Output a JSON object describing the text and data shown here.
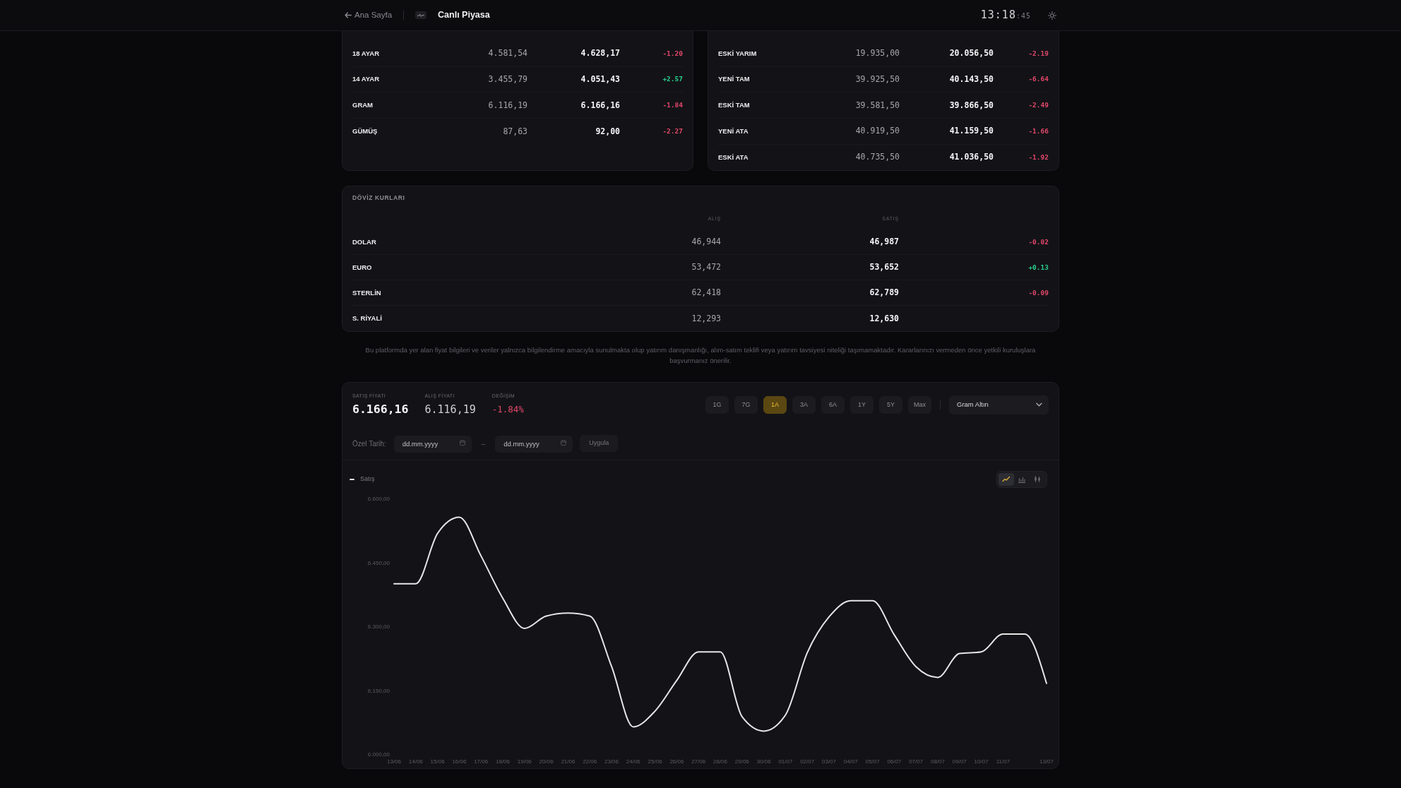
{
  "header": {
    "back_link": "Ana Sayfa",
    "title": "Canlı Piyasa",
    "clock": {
      "time": "13:18",
      "seconds": ":45"
    }
  },
  "gold_tables": [
    {
      "rows": [
        {
          "name": "18 AYAR",
          "buy": "4.581,54",
          "sell": "4.628,17",
          "change": "-1.20",
          "color": "#e2476a"
        },
        {
          "name": "14 AYAR",
          "buy": "3.455,79",
          "sell": "4.051,43",
          "change": "+2.57",
          "color": "#2bcf8e"
        },
        {
          "name": "GRAM",
          "buy": "6.116,19",
          "sell": "6.166,16",
          "change": "-1.84",
          "color": "#e2476a"
        },
        {
          "name": "GÜMÜŞ",
          "buy": "87,63",
          "sell": "92,00",
          "change": "-2.27",
          "color": "#e2476a"
        }
      ]
    },
    {
      "rows": [
        {
          "name": "ESKİ YARIM",
          "buy": "19.935,00",
          "sell": "20.056,50",
          "change": "-2.19",
          "color": "#e2476a"
        },
        {
          "name": "YENİ TAM",
          "buy": "39.925,50",
          "sell": "40.143,50",
          "change": "-6.64",
          "color": "#e2476a"
        },
        {
          "name": "ESKİ TAM",
          "buy": "39.581,50",
          "sell": "39.866,50",
          "change": "-2.49",
          "color": "#e2476a"
        },
        {
          "name": "YENİ ATA",
          "buy": "40.919,50",
          "sell": "41.159,50",
          "change": "-1.66",
          "color": "#e2476a"
        },
        {
          "name": "ESKİ ATA",
          "buy": "40.735,50",
          "sell": "41.036,50",
          "change": "-1.92",
          "color": "#e2476a"
        }
      ]
    }
  ],
  "currency": {
    "title": "DÖVİZ KURLARI",
    "columns": [
      "ALIŞ",
      "SATIŞ"
    ],
    "rows": [
      {
        "name": "DOLAR",
        "buy": "46,944",
        "sell": "46,987",
        "change": "-0.02",
        "color": "#e2476a"
      },
      {
        "name": "EURO",
        "buy": "53,472",
        "sell": "53,652",
        "change": "+0.13",
        "color": "#2bcf8e"
      },
      {
        "name": "STERLİN",
        "buy": "62,418",
        "sell": "62,789",
        "change": "-0.09",
        "color": "#e2476a"
      },
      {
        "name": "S. RİYALİ",
        "buy": "12,293",
        "sell": "12,630"
      }
    ]
  },
  "disclaimer": "Bu platformda yer alan fiyat bilgileri ve veriler yalnızca bilgilendirme amacıyla sunulmakta olup yatırım danışmanlığı, alım-satım teklifi veya yatırım tavsiyesi niteliği taşımamaktadır. Kararlarınızı vermeden önce yetkili kuruluşlara başvurmanız önerilir.",
  "chart_panel": {
    "stats": [
      {
        "kind": "primary",
        "label": "SATIŞ FİYATI",
        "value": "6.166,16"
      },
      {
        "kind": "secondary",
        "label": "ALIŞ FİYATI",
        "value": "6.116,19"
      },
      {
        "kind": "change",
        "label": "DEĞİŞİM",
        "value": "-1.84%",
        "color": "#e2476a"
      }
    ],
    "periods": [
      {
        "label": "1G",
        "selected": false
      },
      {
        "label": "7G",
        "selected": false
      },
      {
        "label": "1A",
        "selected": true
      },
      {
        "label": "3A",
        "selected": false
      },
      {
        "label": "6A",
        "selected": false
      },
      {
        "label": "1Y",
        "selected": false
      },
      {
        "label": "5Y",
        "selected": false
      },
      {
        "label": "Max",
        "selected": false
      }
    ],
    "instrument": "Gram Altın",
    "custom_range": {
      "label": "Özel Tarih:",
      "start_placeholder": "dd.mm.yyyy",
      "separator": "–",
      "end_placeholder": "dd.mm.yyyy",
      "apply": "Uygula",
      "apply_disabled": true
    },
    "chart_types": [
      {
        "kind": "line",
        "selected": true
      },
      {
        "kind": "bar",
        "selected": false
      },
      {
        "kind": "candle",
        "selected": false
      }
    ],
    "chart_data": {
      "type": "line",
      "categories": [
        "13/06",
        "14/06",
        "15/06",
        "16/06",
        "17/06",
        "18/06",
        "19/06",
        "20/06",
        "21/06",
        "22/06",
        "23/06",
        "24/06",
        "25/06",
        "26/06",
        "27/06",
        "28/06",
        "29/06",
        "30/06",
        "01/07",
        "02/07",
        "03/07",
        "04/07",
        "05/07",
        "06/07",
        "07/07",
        "08/07",
        "09/07",
        "10/07",
        "11/07",
        null,
        "13/07"
      ],
      "series": [
        {
          "name": "Satış",
          "color": "#e6e6e8",
          "values": [
            6400,
            6400,
            6518,
            6556,
            6465,
            6366,
            6295,
            6324,
            6331,
            6324,
            6206,
            6064,
            6101,
            6173,
            6240,
            6240,
            6088,
            6054,
            6092,
            6238,
            6322,
            6360,
            6360,
            6280,
            6205,
            6180,
            6236,
            6240,
            6282,
            6282,
            6166
          ]
        }
      ],
      "ylim": [
        6000,
        6600
      ],
      "yticks": [
        {
          "value": 6000,
          "label": "6.000,00"
        },
        {
          "value": 6150,
          "label": "6.150,00"
        },
        {
          "value": 6300,
          "label": "6.300,00"
        },
        {
          "value": 6450,
          "label": "6.450,00"
        },
        {
          "value": 6600,
          "label": "6.600,00"
        }
      ]
    }
  }
}
